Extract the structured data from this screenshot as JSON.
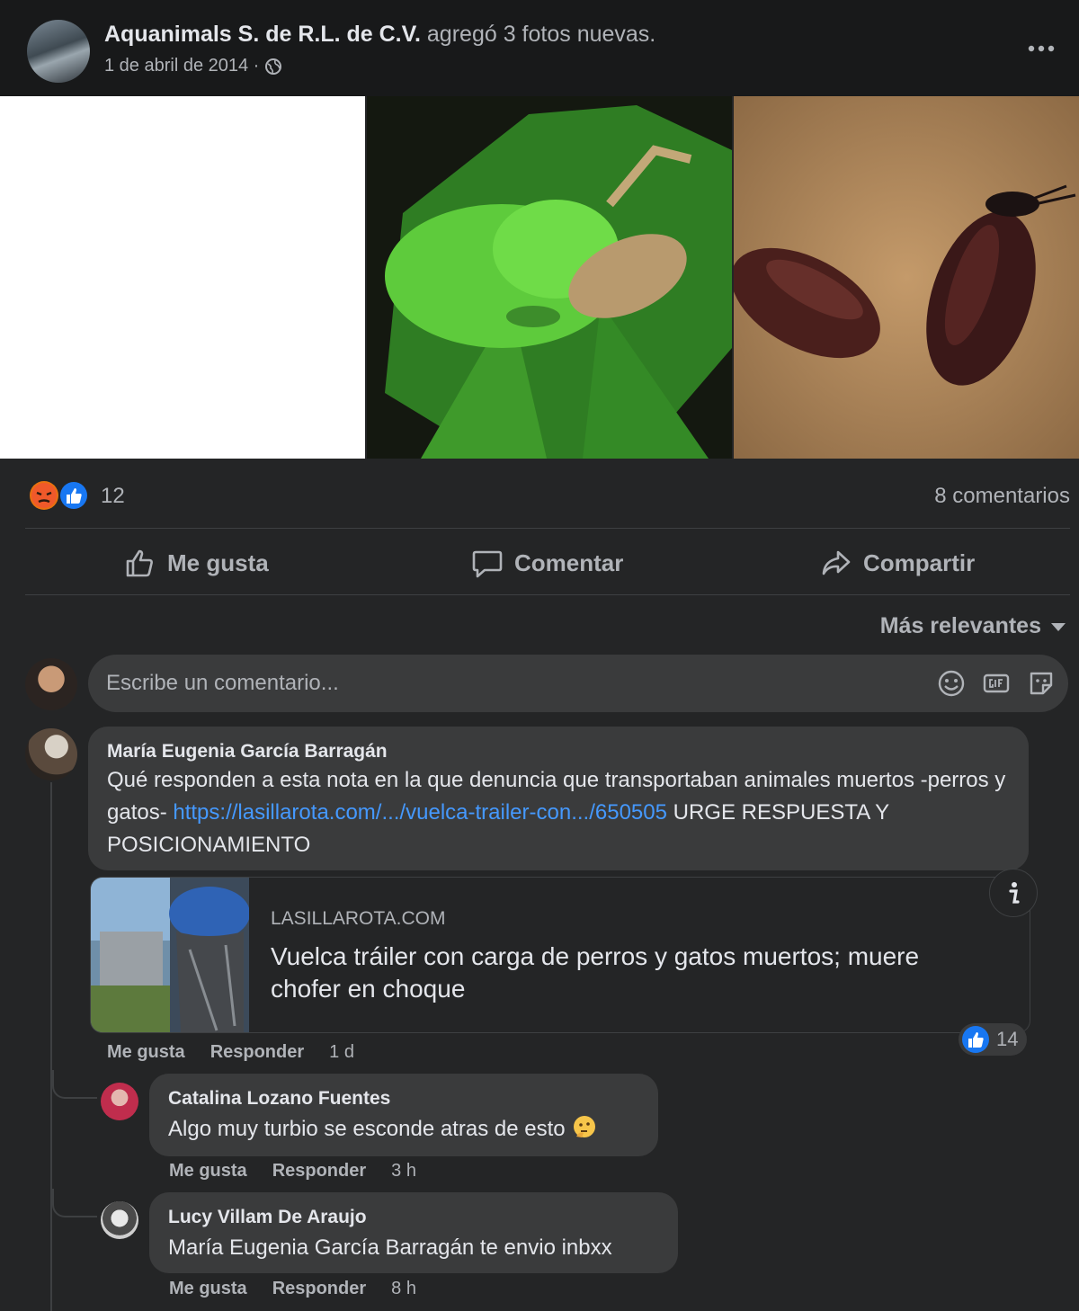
{
  "post": {
    "page_name": "Aquanimals S. de R.L. de C.V.",
    "action_text": "agregó 3 fotos nuevas.",
    "date": "1 de abril de 2014 ·",
    "privacy_icon": "globe-icon",
    "more_icon": "more-icon"
  },
  "reactions": {
    "icons": [
      "angry-reaction-icon",
      "like-reaction-icon"
    ],
    "count": "12",
    "comments_count": "8 comentarios"
  },
  "actions": {
    "like": "Me gusta",
    "comment": "Comentar",
    "share": "Compartir"
  },
  "sort": {
    "label": "Más relevantes"
  },
  "composer": {
    "placeholder": "Escribe un comentario..."
  },
  "comments": [
    {
      "author": "María Eugenia García Barragán",
      "text_before": "Qué responden a esta nota en la que denuncia que transportaban animales muertos -perros y gatos- ",
      "link": "https://lasillarota.com/.../vuelca-trailer-con.../650505",
      "text_after": " URGE RESPUESTA Y POSICIONAMIENTO",
      "preview": {
        "domain": "LASILLAROTA.COM",
        "title": "Vuelca tráiler con carga de perros y gatos muertos; muere chofer en choque"
      },
      "like": "Me gusta",
      "reply": "Responder",
      "time": "1 d",
      "reaction_count": "14"
    },
    {
      "author": "Catalina Lozano Fuentes",
      "text": "Algo muy turbio se esconde atras de esto",
      "like": "Me gusta",
      "reply": "Responder",
      "time": "3 h"
    },
    {
      "author": "Lucy Villam De Araujo",
      "text": "María Eugenia García Barragán te envio inbxx",
      "like": "Me gusta",
      "reply": "Responder",
      "time": "8 h"
    }
  ],
  "colors": {
    "background": "#242526",
    "header": "#18191a",
    "bubble": "#3a3b3c",
    "text": "#e4e6eb",
    "muted": "#b0b3b8",
    "link": "#4599ff",
    "like_blue": "#1877f2"
  }
}
